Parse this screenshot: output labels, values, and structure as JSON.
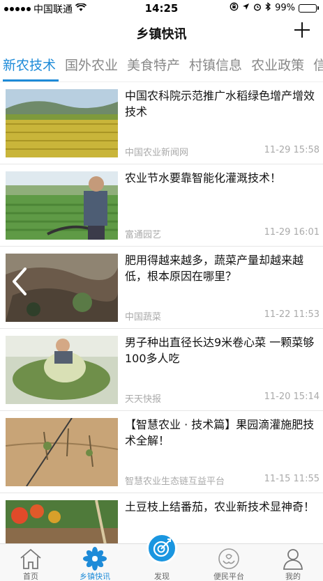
{
  "status_bar": {
    "carrier": "中国联通",
    "time": "14:25",
    "battery": "99%",
    "battery_level": 0.99
  },
  "nav": {
    "title": "乡镇快讯"
  },
  "tabs": [
    {
      "label": "新农技术",
      "active": true
    },
    {
      "label": "国外农业",
      "active": false
    },
    {
      "label": "美食特产",
      "active": false
    },
    {
      "label": "村镇信息",
      "active": false
    },
    {
      "label": "农业政策",
      "active": false
    },
    {
      "label": "信",
      "active": false
    }
  ],
  "articles": [
    {
      "title": "中国农科院示范推广水稻绿色增产增效技术",
      "source": "中国农业新闻网",
      "time": "11-29 15:58"
    },
    {
      "title": "农业节水要靠智能化灌溉技术！",
      "source": "富通园艺",
      "time": "11-29 16:01"
    },
    {
      "title": "肥用得越来越多，蔬菜产量却越来越低，根本原因在哪里？",
      "source": "中国蔬菜",
      "time": "11-22 11:53"
    },
    {
      "title": "男子种出直径长达9米卷心菜 一颗菜够100多人吃",
      "source": "天天快报",
      "time": "11-20 15:14"
    },
    {
      "title": "【智慧农业 · 技术篇】果园滴灌施肥技术全解！",
      "source": "智慧农业生态链互益平台",
      "time": "11-15 11:55"
    },
    {
      "title": "土豆枝上结番茄，农业新技术显神奇！",
      "source": "",
      "time": ""
    }
  ],
  "tabbar": [
    {
      "label": "首页",
      "icon": "home-icon",
      "active": false
    },
    {
      "label": "乡镇快讯",
      "icon": "flower-icon",
      "active": true
    },
    {
      "label": "发现",
      "icon": "target-icon",
      "active": false
    },
    {
      "label": "便民平台",
      "icon": "hands-icon",
      "active": false
    },
    {
      "label": "我的",
      "icon": "user-icon",
      "active": false
    }
  ],
  "colors": {
    "accent": "#1e8bd8",
    "text": "#111111",
    "muted": "#aaaaaa"
  }
}
